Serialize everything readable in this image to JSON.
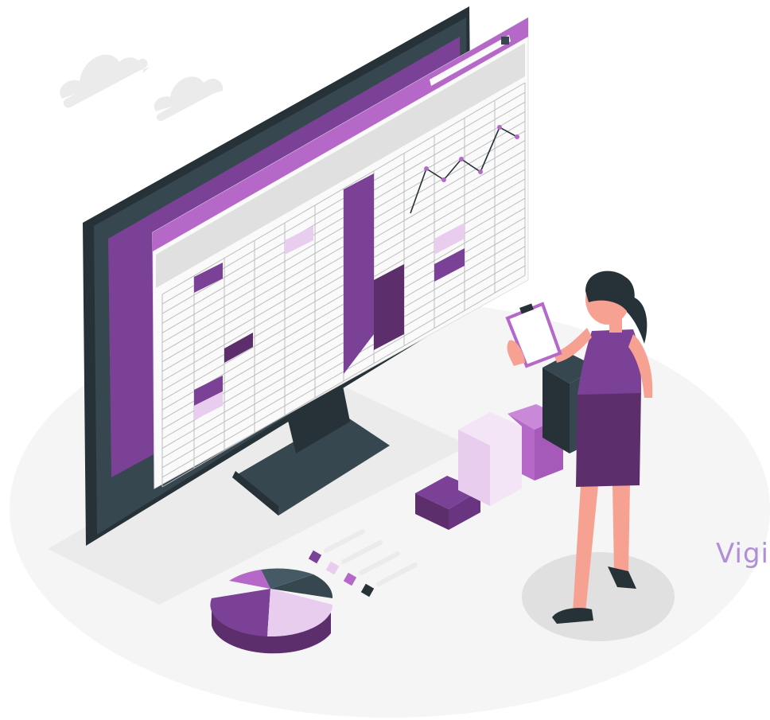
{
  "caption": {
    "text": "Vigi"
  },
  "colors": {
    "purple": "#7b4196",
    "purple_light": "#b568c8",
    "purple_pale": "#e8cdee",
    "purple_dark": "#5d2e6c",
    "monitor": "#37474f",
    "monitor_dark": "#263238",
    "floor": "#f5f5f5",
    "skin": "#f7a193",
    "hair": "#263238",
    "grid_line": "#bdbdbd",
    "caption": "#b08fd6"
  },
  "icons": [
    "cloud-icon",
    "monitor",
    "spreadsheet-window",
    "line-chart",
    "pie-chart",
    "bar-cubes",
    "person-with-clipboard"
  ]
}
